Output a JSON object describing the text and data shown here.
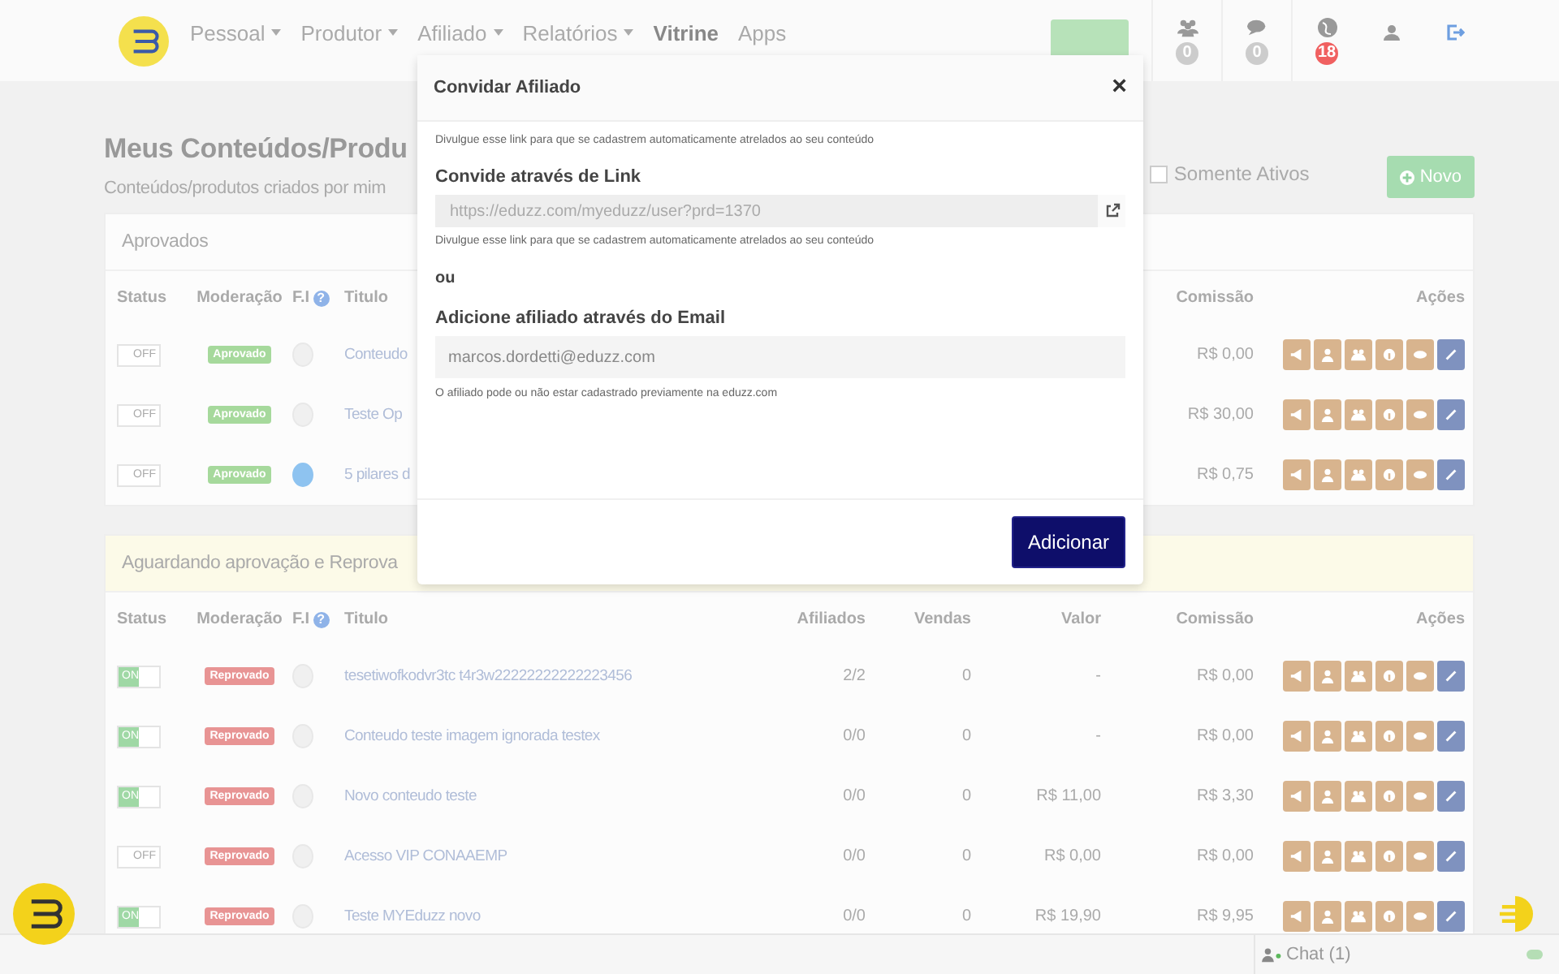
{
  "nav": {
    "items": [
      {
        "label": "Pessoal",
        "dropdown": true,
        "selected": false
      },
      {
        "label": "Produtor",
        "dropdown": true,
        "selected": false
      },
      {
        "label": "Afiliado",
        "dropdown": true,
        "selected": false
      },
      {
        "label": "Relatórios",
        "dropdown": true,
        "selected": false
      },
      {
        "label": "Vitrine",
        "dropdown": false,
        "selected": true
      },
      {
        "label": "Apps",
        "dropdown": false,
        "selected": false
      }
    ],
    "counters": [
      {
        "count": "0",
        "alert": false
      },
      {
        "count": "0",
        "alert": false
      },
      {
        "count": "18",
        "alert": true
      }
    ]
  },
  "page": {
    "title": "Meus Conteúdos/Produ",
    "subtitle": "Conteúdos/produtos criados por mim",
    "filter": {
      "label": "Somente Ativos",
      "checked": false
    },
    "new_button": "Novo"
  },
  "panels": [
    {
      "title": "Aprovados",
      "highlight": false,
      "header": {
        "status": "Status",
        "moderation": "Moderação",
        "fi": "F.I",
        "fi_help": "?",
        "title": "Titulo",
        "commission": "Comissão",
        "actions": "Ações"
      },
      "rows": [
        {
          "on": false,
          "toggle": "OFF",
          "moderation": "Aprovado",
          "approved": true,
          "fi_image": false,
          "title": "Conteudo",
          "commission": "R$ 0,00"
        },
        {
          "on": false,
          "toggle": "OFF",
          "moderation": "Aprovado",
          "approved": true,
          "fi_image": false,
          "title": "Teste Op",
          "commission": "R$ 30,00"
        },
        {
          "on": false,
          "toggle": "OFF",
          "moderation": "Aprovado",
          "approved": true,
          "fi_image": true,
          "title": "5 pilares d",
          "commission": "R$ 0,75"
        }
      ]
    },
    {
      "title": "Aguardando aprovação e Reprova",
      "highlight": true,
      "header": {
        "status": "Status",
        "moderation": "Moderação",
        "fi": "F.I",
        "fi_help": "?",
        "title": "Titulo",
        "affiliates": "Afiliados",
        "sales": "Vendas",
        "value": "Valor",
        "commission": "Comissão",
        "actions": "Ações"
      },
      "rows": [
        {
          "on": true,
          "toggle": "ON",
          "moderation": "Reprovado",
          "approved": false,
          "fi_image": false,
          "title": "tesetiwofkodvr3tc t4r3w22222222222223456",
          "affiliates": "2/2",
          "sales": "0",
          "value": "-",
          "commission": "R$ 0,00"
        },
        {
          "on": true,
          "toggle": "ON",
          "moderation": "Reprovado",
          "approved": false,
          "fi_image": false,
          "title": "Conteudo teste imagem ignorada testex",
          "affiliates": "0/0",
          "sales": "0",
          "value": "-",
          "commission": "R$ 0,00"
        },
        {
          "on": true,
          "toggle": "ON",
          "moderation": "Reprovado",
          "approved": false,
          "fi_image": false,
          "title": "Novo conteudo teste",
          "affiliates": "0/0",
          "sales": "0",
          "value": "R$ 11,00",
          "commission": "R$ 3,30"
        },
        {
          "on": false,
          "toggle": "OFF",
          "moderation": "Reprovado",
          "approved": false,
          "fi_image": false,
          "title": "Acesso VIP CONAAEMP",
          "affiliates": "0/0",
          "sales": "0",
          "value": "R$ 0,00",
          "commission": "R$ 0,00"
        },
        {
          "on": true,
          "toggle": "ON",
          "moderation": "Reprovado",
          "approved": false,
          "fi_image": false,
          "title": "Teste MYEduzz novo",
          "affiliates": "0/0",
          "sales": "0",
          "value": "R$ 19,90",
          "commission": "R$ 9,95"
        }
      ]
    }
  ],
  "modal": {
    "title": "Convidar Afiliado",
    "close": "×",
    "intro": "Divulgue esse link para que se cadastrem automaticamente atrelados ao seu conteúdo",
    "link_heading": "Convide através de Link",
    "link": "https://eduzz.com/myeduzz/user?prd=1370",
    "link_help": "Divulgue esse link para que se cadastrem automaticamente atrelados ao seu conteúdo",
    "or": "ou",
    "email_heading": "Adicione afiliado através do Email",
    "email": "marcos.dordetti@eduzz.com",
    "email_help": "O afiliado pode ou não estar cadastrado previamente na eduzz.com",
    "submit": "Adicionar"
  },
  "chat": {
    "label": "Chat (1)",
    "on": true
  }
}
